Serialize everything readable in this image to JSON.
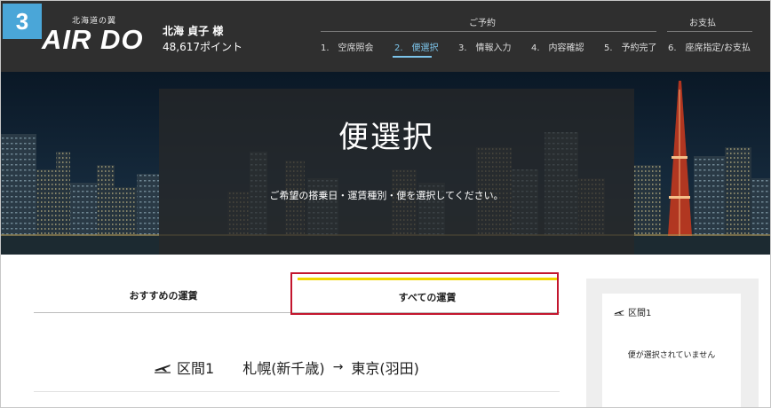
{
  "header": {
    "step_number": "3",
    "logo_tagline": "北海道の翼",
    "logo_text": "AIR DO",
    "user_name": "北海 貞子 様",
    "user_points": "48,617ポイント",
    "group_reservation": "ご予約",
    "group_payment": "お支払",
    "steps": [
      {
        "label": "1.　空席照会"
      },
      {
        "label": "2.　便選択"
      },
      {
        "label": "3.　情報入力"
      },
      {
        "label": "4.　内容確認"
      },
      {
        "label": "5.　予約完了"
      },
      {
        "label": "6.　座席指定/お支払"
      }
    ],
    "active_step": 2,
    "accent_color": "#7cc4ea"
  },
  "hero": {
    "title": "便選択",
    "subtitle": "ご希望の搭乗日・運賃種別・便を選択してください。"
  },
  "tabs": [
    {
      "label": "おすすめの運賃"
    },
    {
      "label": "すべての運賃"
    }
  ],
  "selected_tab": 1,
  "segment": {
    "icon": "airplane-icon",
    "label": "区間1",
    "origin": "札幌(新千歳)",
    "arrow": "→",
    "destination": "東京(羽田)"
  },
  "side_panel": {
    "segment_label": "区間1",
    "empty_message": "便が選択されていません"
  },
  "colors": {
    "header_bg": "#2f2f2f",
    "step_badge": "#4aa6d8",
    "tab_accent": "#f1d500",
    "highlight": "#c3162d"
  }
}
